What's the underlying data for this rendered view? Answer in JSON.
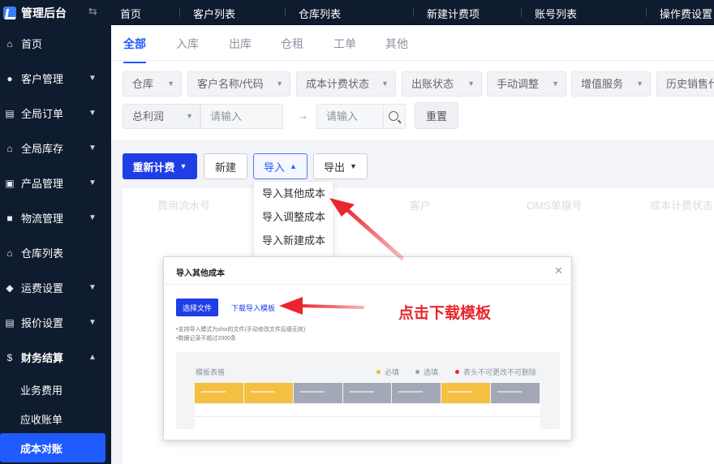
{
  "brand": {
    "title": "管理后台"
  },
  "topnav": [
    "首页",
    "客户列表",
    "仓库列表",
    "新建计费项",
    "账号列表",
    "操作费设置"
  ],
  "sidebar": {
    "items": [
      {
        "label": "首页",
        "icon": "home-icon"
      },
      {
        "label": "客户管理",
        "icon": "users-icon"
      },
      {
        "label": "全局订单",
        "icon": "orders-icon"
      },
      {
        "label": "全局库存",
        "icon": "warehouse-icon"
      },
      {
        "label": "产品管理",
        "icon": "box-icon"
      },
      {
        "label": "物流管理",
        "icon": "truck-icon"
      },
      {
        "label": "仓库列表",
        "icon": "building-icon"
      },
      {
        "label": "运费设置",
        "icon": "cube-icon"
      },
      {
        "label": "报价设置",
        "icon": "document-icon"
      },
      {
        "label": "财务结算",
        "icon": "dollar-icon"
      }
    ],
    "sub_items": [
      "业务费用",
      "应收账单",
      "成本对账"
    ]
  },
  "tabs": [
    "全部",
    "入库",
    "出库",
    "仓租",
    "工单",
    "其他"
  ],
  "filters": {
    "row1": [
      "仓库",
      "客户名称/代码",
      "成本计费状态",
      "出账状态",
      "手动调整",
      "增值服务",
      "历史销售代"
    ],
    "profit_select": "总利润",
    "min_placeholder": "请输入",
    "max_placeholder": "请输入",
    "reset": "重置"
  },
  "toolbar": {
    "recalc": "重新计费",
    "new": "新建",
    "import": "导入",
    "export": "导出"
  },
  "table_headers": [
    "费用流水号",
    "客户",
    "OMS单据号",
    "成本计费状态"
  ],
  "import_menu": [
    "导入其他成本",
    "导入调整成本",
    "导入新建成本"
  ],
  "modal": {
    "title": "导入其他成本",
    "select_file": "选择文件",
    "download_link": "下载导入模板",
    "notes": [
      "•支持导入模式为xlsx的文件(手动修改文件后缀无效)",
      "•数据记录不超过2000条"
    ],
    "template_title": "模板表格",
    "legend": [
      {
        "label": "必填",
        "color": "#f5b82e"
      },
      {
        "label": "选填",
        "color": "#9aa0ad"
      },
      {
        "label": "表头不可更改不可删除",
        "color": "#e8262c"
      }
    ],
    "column_colors": [
      "#f5c042",
      "#f5c042",
      "#a3a8b7",
      "#a3a8b7",
      "#a3a8b7",
      "#f5c042",
      "#a3a8b7"
    ]
  },
  "annotation": "点击下载模板"
}
